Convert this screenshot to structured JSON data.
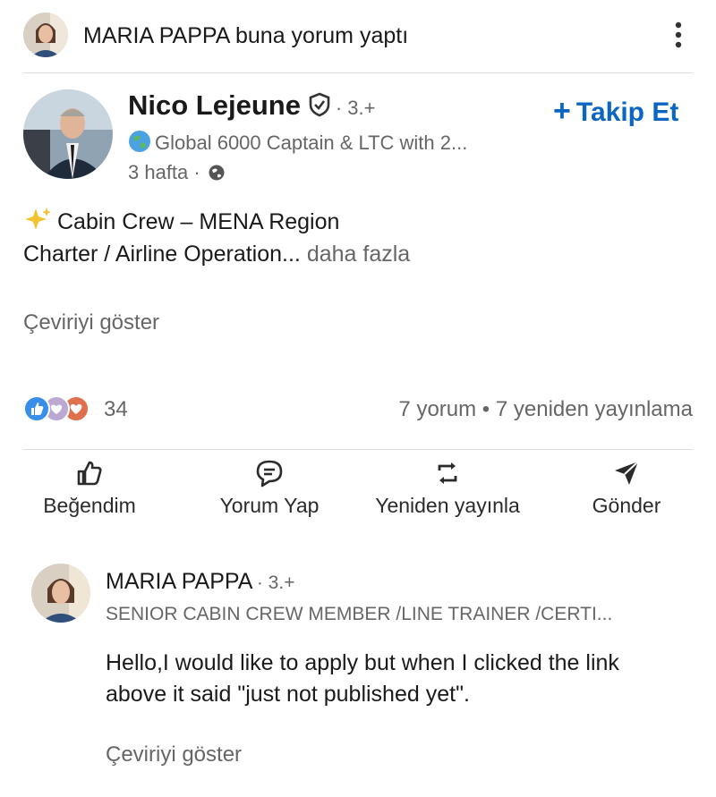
{
  "activity": {
    "actor": "MARIA PAPPA",
    "action_text": "buna yorum yaptı",
    "more_icon": "more-vertical-icon"
  },
  "post": {
    "author_name": "Nico Lejeune",
    "verified_icon": "verified-shield-icon",
    "degree": "· 3.+",
    "headline": "Global 6000 Captain & LTC with 2...",
    "time": "3 hafta ·",
    "visibility_icon": "globe-icon",
    "follow_label": "Takip Et",
    "body_line1": "Cabin Crew – MENA Region",
    "body_line2": "Charter / Airline Operation...",
    "more_label": "daha fazla",
    "translate_label": "Çeviriyi göster",
    "reaction_count": "34",
    "comments_reposts": "7 yorum • 7 yeniden yayınlama"
  },
  "actions": [
    {
      "label": "Beğendim",
      "icon": "thumbs-up-icon"
    },
    {
      "label": "Yorum Yap",
      "icon": "comment-icon"
    },
    {
      "label": "Yeniden yayınla",
      "icon": "repost-icon"
    },
    {
      "label": "Gönder",
      "icon": "send-icon"
    }
  ],
  "comment": {
    "author_name": "MARIA PAPPA",
    "degree": "· 3.+",
    "headline": "SENIOR CABIN CREW MEMBER /LINE TRAINER /CERTI...",
    "text": "Hello,I would like to apply but when I clicked the link above it said \"just not published yet\".",
    "translate_label": "Çeviriyi göster"
  },
  "colors": {
    "accent": "#0a66c2",
    "text": "#1a1a1a",
    "muted": "#666666",
    "divider": "#dcdcdc"
  }
}
